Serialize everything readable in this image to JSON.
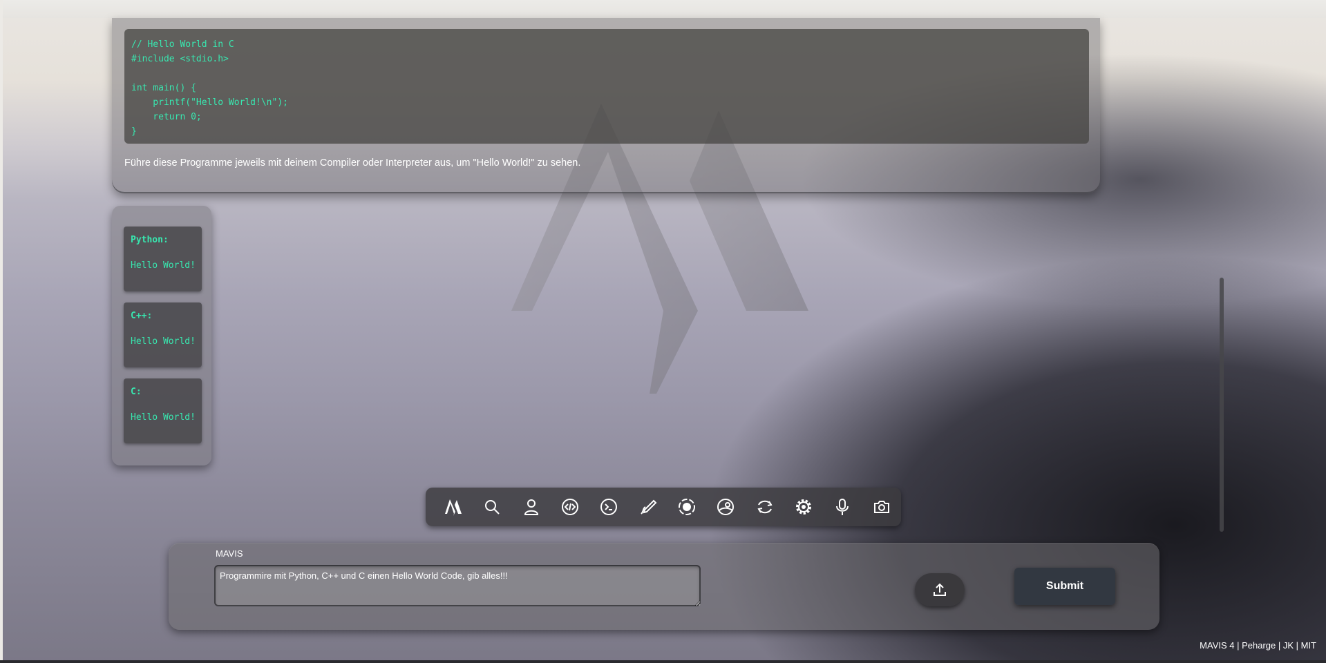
{
  "response": {
    "code_lines": [
      "// Hello World in C",
      "#include <stdio.h>",
      "",
      "int main() {",
      "    printf(\"Hello World!\\n\");",
      "    return 0;",
      "}"
    ],
    "text": "Führe diese Programme jeweils mit deinem Compiler oder Interpreter aus, um \"Hello World!\" zu sehen."
  },
  "outputs": [
    {
      "lang": "Python:",
      "text": "Hello World!"
    },
    {
      "lang": "C++:",
      "text": "Hello World!"
    },
    {
      "lang": "C:",
      "text": "Hello World!"
    }
  ],
  "toolbar": {
    "items": [
      {
        "icon": "mavis-logo-icon"
      },
      {
        "icon": "search-icon"
      },
      {
        "icon": "user-icon"
      },
      {
        "icon": "code-icon"
      },
      {
        "icon": "terminal-icon"
      },
      {
        "icon": "draw-icon"
      },
      {
        "icon": "record-icon"
      },
      {
        "icon": "profile-icon"
      },
      {
        "icon": "refresh-icon"
      },
      {
        "icon": "settings-icon"
      },
      {
        "icon": "microphone-icon"
      },
      {
        "icon": "camera-icon"
      }
    ]
  },
  "input": {
    "label": "MAVIS",
    "value": "Programmire mit Python, C++ und C einen Hello World Code, gib alles!!!",
    "upload_icon": "upload-icon",
    "submit_label": "Submit"
  },
  "footer": {
    "text": "MAVIS 4 | Peharge | JK | MIT"
  },
  "colors": {
    "code_text": "#38e8b0",
    "panel": "#6e6c70",
    "submit_bg": "#303640"
  }
}
